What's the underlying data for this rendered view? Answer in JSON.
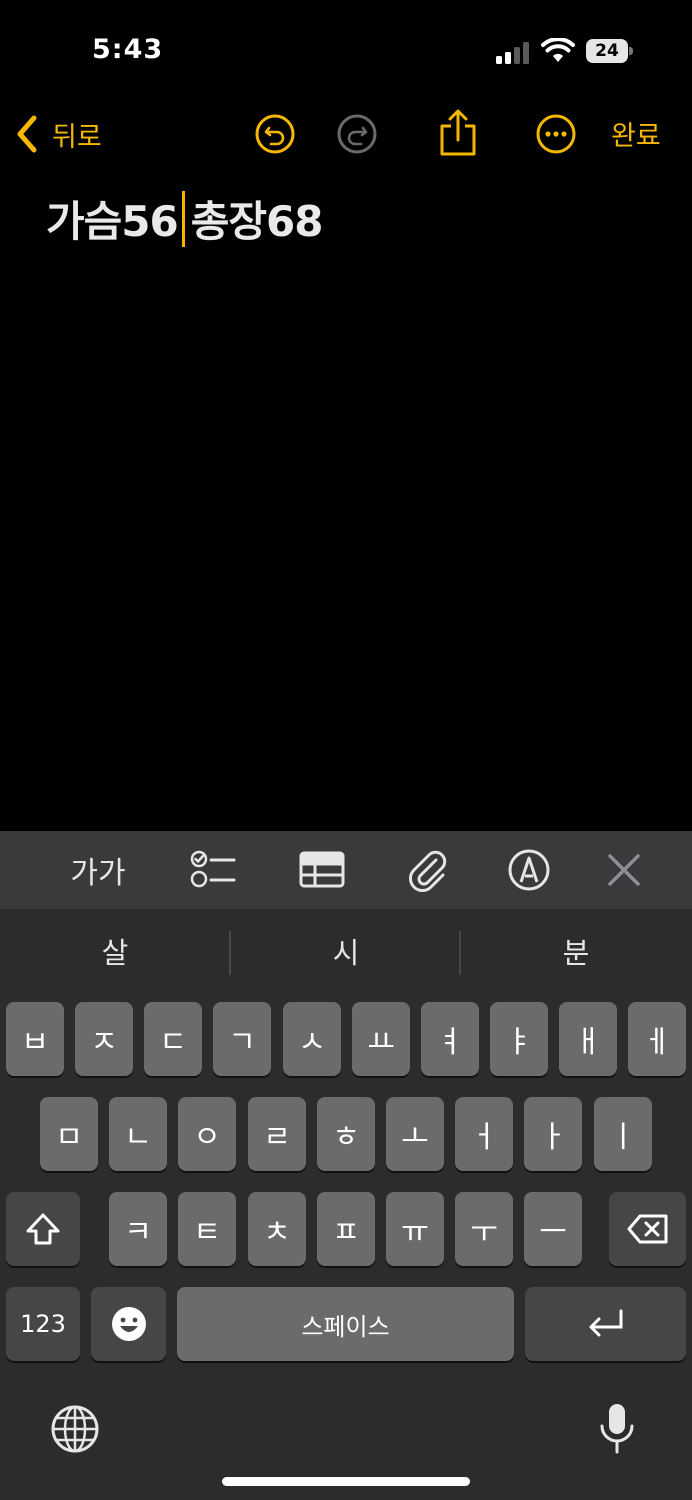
{
  "status_bar": {
    "time": "5:43",
    "battery_level": "24"
  },
  "nav": {
    "back_label": "뒤로",
    "done_label": "완료"
  },
  "note": {
    "text_before_cursor": "가슴56",
    "text_after_cursor": "총장68"
  },
  "toolbar": {
    "format_label": "가가"
  },
  "suggestions": [
    "살",
    "시",
    "분"
  ],
  "keys": {
    "row1": [
      "ㅂ",
      "ㅈ",
      "ㄷ",
      "ㄱ",
      "ㅅ",
      "ㅛ",
      "ㅕ",
      "ㅑ",
      "ㅐ",
      "ㅔ"
    ],
    "row2": [
      "ㅁ",
      "ㄴ",
      "ㅇ",
      "ㄹ",
      "ㅎ",
      "ㅗ",
      "ㅓ",
      "ㅏ",
      "ㅣ"
    ],
    "row3": [
      "ㅋ",
      "ㅌ",
      "ㅊ",
      "ㅍ",
      "ㅠ",
      "ㅜ",
      "ㅡ"
    ],
    "numbers_label": "123",
    "space_label": "스페이스"
  },
  "colors": {
    "accent": "#F5B700",
    "key": "#6b6b6e",
    "keyboard_bg": "#2c2c2e"
  }
}
